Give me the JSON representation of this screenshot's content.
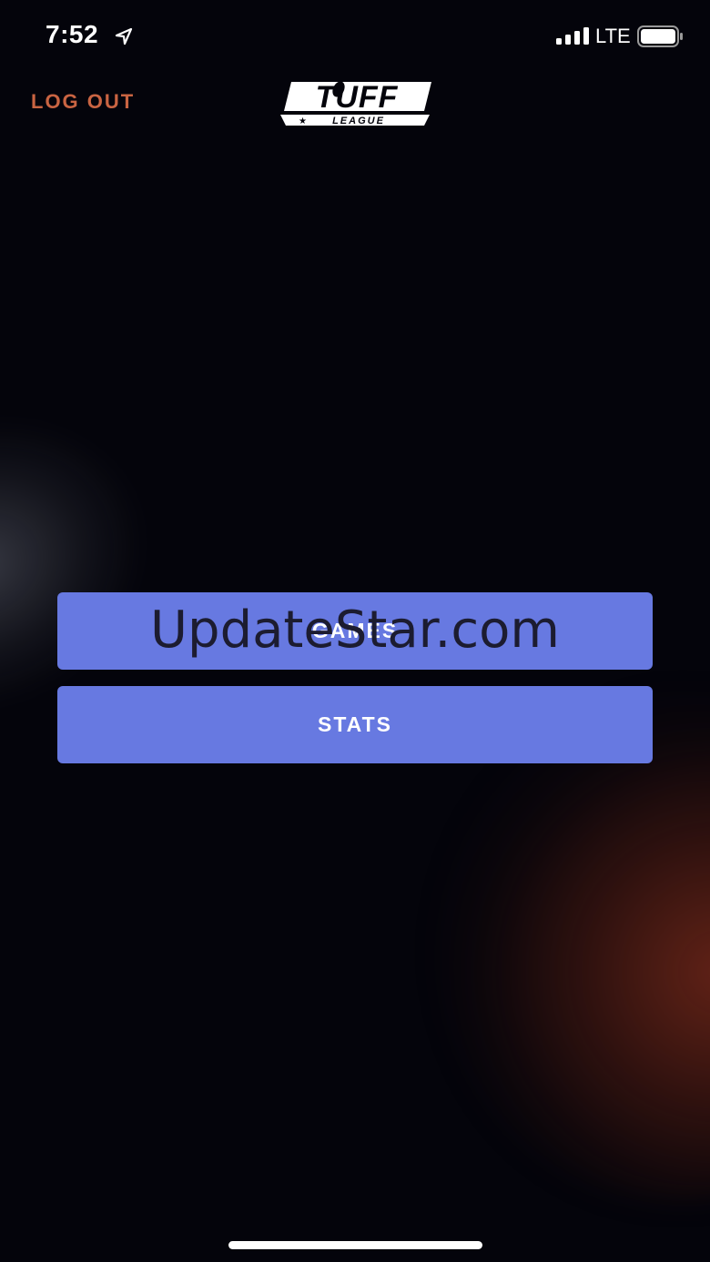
{
  "status_bar": {
    "time": "7:52",
    "network": "LTE",
    "icons": [
      "location-arrow-icon",
      "signal-bars-icon",
      "battery-icon"
    ]
  },
  "header": {
    "logout_label": "LOG OUT",
    "logo": {
      "main": "TUFF",
      "sub": "LEAGUE"
    }
  },
  "menu": {
    "games_label": "GAMES",
    "stats_label": "STATS"
  },
  "watermark": "UpdateStar.com",
  "colors": {
    "background": "#04040b",
    "accent_button": "#6779e1",
    "logout": "#c96442",
    "text": "#ffffff"
  }
}
